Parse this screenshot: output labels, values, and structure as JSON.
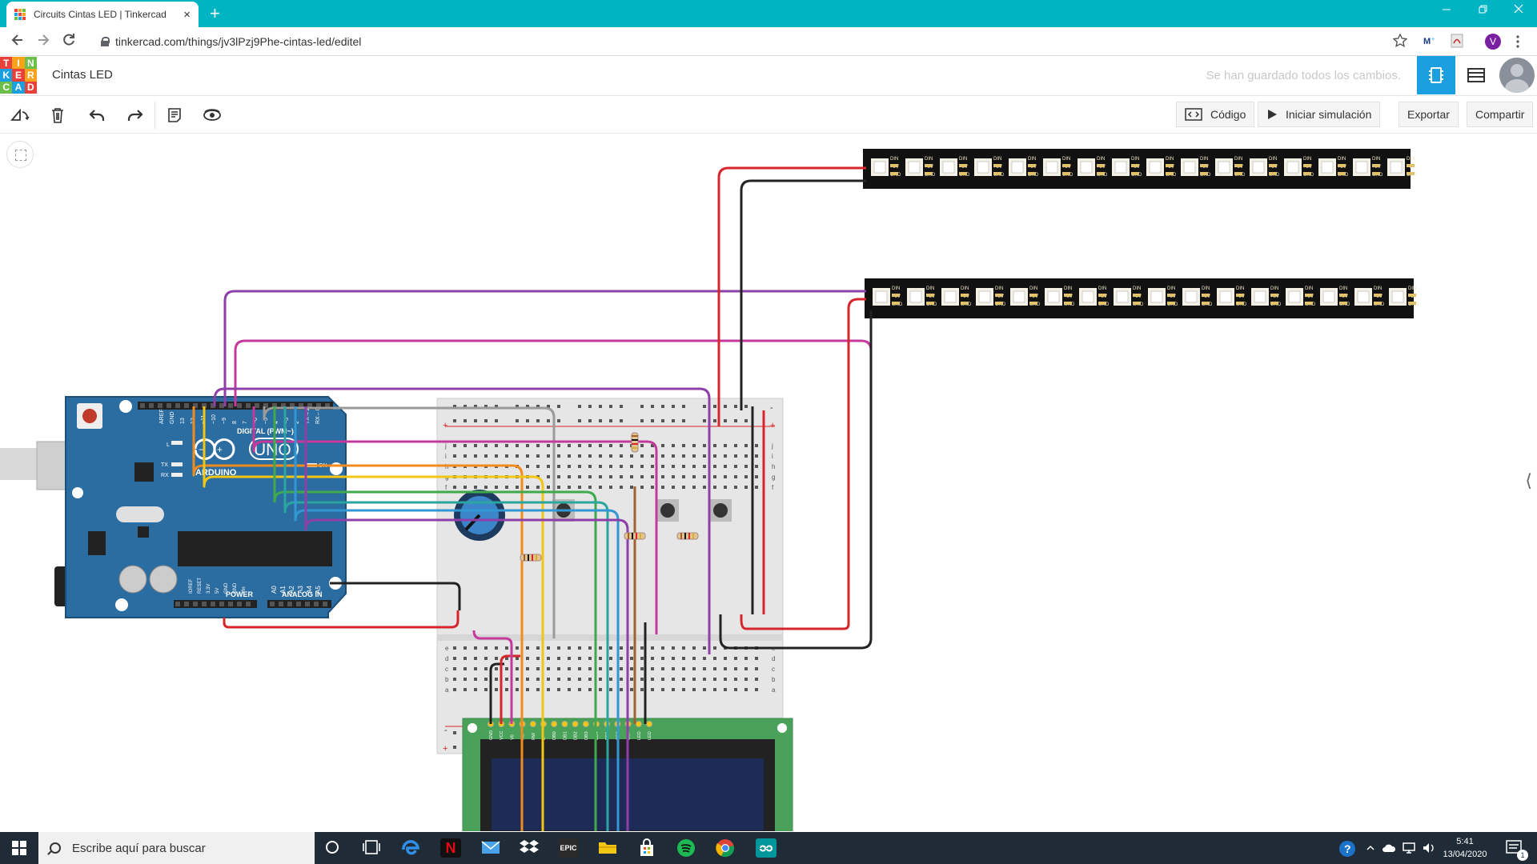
{
  "browser": {
    "tab_title": "Circuits Cintas LED | Tinkercad",
    "tab_close": "×",
    "new_tab": "+",
    "url": "tinkercad.com/things/jv3lPzj9Phe-cintas-led/editel",
    "profile_initial": "V",
    "icons": [
      "back-icon",
      "forward-icon",
      "reload-icon",
      "lock-icon",
      "star-icon",
      "menu-icon"
    ]
  },
  "header": {
    "logo_letters": [
      "T",
      "I",
      "N",
      "K",
      "E",
      "R",
      "C",
      "A",
      "D"
    ],
    "logo_colors": [
      "#e8413a",
      "#f9a21c",
      "#6cc04a",
      "#1a9fe0",
      "#e8413a",
      "#f9a21c",
      "#6cc04a",
      "#1a9fe0",
      "#e8413a"
    ],
    "design_title": "Cintas LED",
    "save_status": "Se han guardado todos los cambios."
  },
  "toolbar": {
    "tools": [
      "rotate-icon",
      "delete-icon",
      "undo-icon",
      "redo-icon",
      "notes-icon",
      "visibility-icon"
    ],
    "code_label": "Código",
    "simulate_label": "Iniciar simulación",
    "export_label": "Exportar",
    "share_label": "Compartir"
  },
  "canvas": {
    "components": [
      "arduino-uno",
      "breadboard",
      "potentiometer",
      "pushbutton",
      "pushbutton",
      "pushbutton",
      "resistor",
      "resistor",
      "resistor",
      "resistor",
      "lcd-16x2",
      "neopixel-strip",
      "neopixel-strip"
    ],
    "arduino": {
      "brand": "ARDUINO",
      "model": "UNO",
      "digital_label": "DIGITAL (PWM~)",
      "power_label": "POWER",
      "analog_label": "ANALOG IN",
      "on_label": "ON",
      "tx_label": "TX",
      "rx_label": "RX",
      "l_label": "L",
      "digital_pins": [
        "AREF",
        "GND",
        "13",
        "12",
        "~11",
        "~10",
        "~9",
        "8",
        "7",
        "~6",
        "~5",
        "4",
        "~3",
        "2",
        "TX→1",
        "RX←0"
      ],
      "power_pins": [
        "IOREF",
        "RESET",
        "3.3V",
        "5V",
        "GND",
        "GND",
        "Vin"
      ],
      "analog_pins": [
        "A0",
        "A1",
        "A2",
        "A3",
        "A4",
        "A5"
      ]
    },
    "breadboard": {
      "row_letters_top": [
        "j",
        "i",
        "h",
        "g",
        "f"
      ],
      "row_letters_bottom": [
        "e",
        "d",
        "c",
        "b",
        "a"
      ],
      "plus": "+",
      "minus": "-"
    },
    "lcd_pins": [
      "GND",
      "VCC",
      "V0",
      "RS",
      "RW",
      "E",
      "DB0",
      "DB1",
      "DB2",
      "DB3",
      "DB4",
      "DB5",
      "DB6",
      "DB7",
      "LED",
      "LED"
    ],
    "strip_labels": [
      "DIN",
      "+5V",
      "GND",
      "DO"
    ],
    "side_toggle": "⟨",
    "wire_colors": {
      "purple": "#8e3fa8",
      "magenta": "#c4399b",
      "orange": "#f08c1d",
      "yellow": "#f3c614",
      "gray": "#9a9a9a",
      "green": "#3faa4c",
      "teal": "#2aa6a0",
      "blue": "#3397d4",
      "red": "#d6262b",
      "black": "#222222",
      "brown": "#a0622d"
    }
  },
  "taskbar": {
    "search_placeholder": "Escribe aquí para buscar",
    "apps": [
      "cortana-icon",
      "task-view-icon",
      "edge-icon",
      "netflix-icon",
      "mail-icon",
      "dropbox-icon",
      "epic-games-icon",
      "file-explorer-icon",
      "store-icon",
      "spotify-icon",
      "chrome-icon",
      "arduino-icon"
    ],
    "epic_label": "EPIC",
    "netflix_label": "N",
    "time": "5:41",
    "date": "13/04/2020",
    "notif_count": "1"
  }
}
